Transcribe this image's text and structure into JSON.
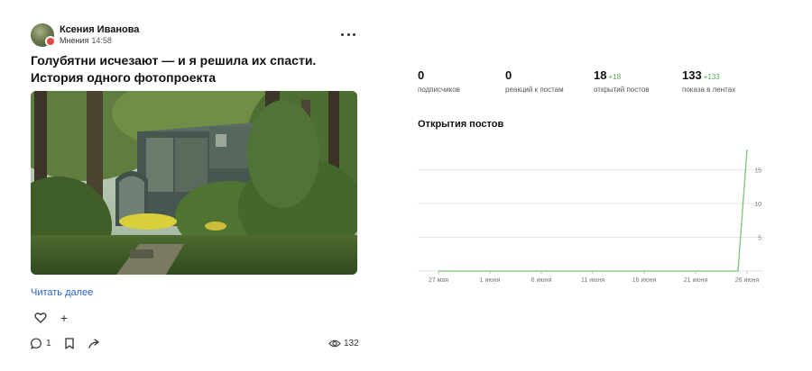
{
  "post": {
    "author": "Ксения Иванова",
    "category": "Мнения",
    "time": "14:58",
    "title": "Голубятни исчезают — и я решила их спасти. История одного фотопроекта",
    "read_more": "Читать далее",
    "comments_count": "1",
    "views_count": "132"
  },
  "icons": {
    "more": "more-dots-icon",
    "like": "heart-icon",
    "add_reaction": "plus-icon",
    "comment": "comment-icon",
    "bookmark": "bookmark-icon",
    "share": "share-arrow-icon",
    "views": "eye-icon"
  },
  "stats": [
    {
      "value": "0",
      "delta": "",
      "label": "подписчиков"
    },
    {
      "value": "0",
      "delta": "",
      "label": "реакций к постам"
    },
    {
      "value": "18",
      "delta": "+18",
      "label": "открытий постов"
    },
    {
      "value": "133",
      "delta": "+133",
      "label": "показа в лентах"
    }
  ],
  "chart": {
    "title": "Открытия постов"
  },
  "chart_data": {
    "type": "line",
    "title": "Открытия постов",
    "x_tick_labels": [
      "27 мая",
      "1 июня",
      "6 июня",
      "11 июня",
      "16 июня",
      "21 июня",
      "26 июня"
    ],
    "y_tick_labels": [
      "5",
      "10",
      "15"
    ],
    "ylim": [
      0,
      18
    ],
    "grid": true,
    "series": [
      {
        "color": "#7cc47c",
        "points": [
          {
            "x": "27 мая",
            "y": 0
          },
          {
            "x": "25 июня",
            "y": 0
          },
          {
            "x": "26 июня",
            "y": 18
          }
        ]
      }
    ],
    "colors": {
      "line": "#7cc47c",
      "grid": "#e6e6e6",
      "delta": "#5aa65a",
      "link": "#2b63c5"
    }
  }
}
